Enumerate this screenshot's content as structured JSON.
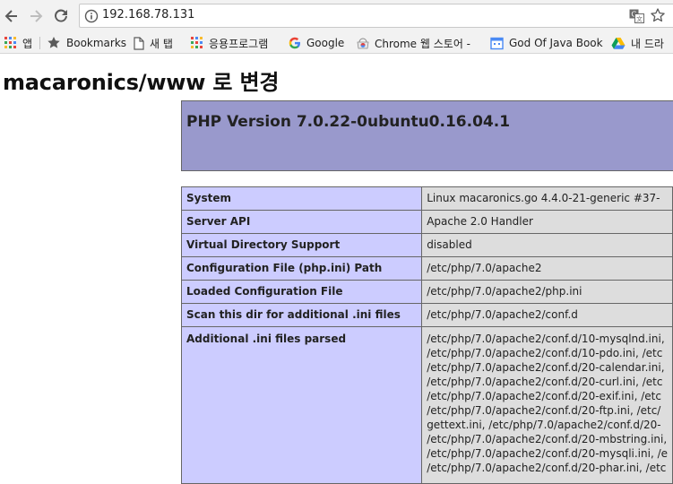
{
  "browser": {
    "url": "192.168.78.131",
    "bookmarks": [
      {
        "label": "앱",
        "icon": "apps-grid-icon"
      },
      {
        "label": "Bookmarks",
        "icon": "star-icon"
      },
      {
        "label": "새 탭",
        "icon": "page-icon"
      },
      {
        "label": "응용프로그램",
        "icon": "apps-grid-icon"
      },
      {
        "label": "Google",
        "icon": "google-icon"
      },
      {
        "label": "Chrome 웹 스토어 -",
        "icon": "webstore-icon"
      },
      {
        "label": "God Of Java Book",
        "icon": "calendar-icon"
      },
      {
        "label": "내 드라",
        "icon": "drive-icon"
      }
    ]
  },
  "page": {
    "title": "macaronics/www 로 변경",
    "php_version": "PHP Version 7.0.22-0ubuntu0.16.04.1",
    "rows": [
      {
        "key": "System",
        "value": "Linux macaronics.go 4.4.0-21-generic #37-"
      },
      {
        "key": "Server API",
        "value": "Apache 2.0 Handler"
      },
      {
        "key": "Virtual Directory Support",
        "value": "disabled"
      },
      {
        "key": "Configuration File (php.ini) Path",
        "value": "/etc/php/7.0/apache2"
      },
      {
        "key": "Loaded Configuration File",
        "value": "/etc/php/7.0/apache2/php.ini"
      },
      {
        "key": "Scan this dir for additional .ini files",
        "value": "/etc/php/7.0/apache2/conf.d"
      }
    ],
    "additional_ini": {
      "key": "Additional .ini files parsed",
      "lines": [
        "/etc/php/7.0/apache2/conf.d/10-mysqlnd.ini,",
        "/etc/php/7.0/apache2/conf.d/10-pdo.ini, /etc",
        "/etc/php/7.0/apache2/conf.d/20-calendar.ini,",
        "/etc/php/7.0/apache2/conf.d/20-curl.ini, /etc",
        "/etc/php/7.0/apache2/conf.d/20-exif.ini, /etc",
        "/etc/php/7.0/apache2/conf.d/20-ftp.ini, /etc/",
        "gettext.ini, /etc/php/7.0/apache2/conf.d/20-",
        "/etc/php/7.0/apache2/conf.d/20-mbstring.ini,",
        "/etc/php/7.0/apache2/conf.d/20-mysqli.ini, /e",
        "/etc/php/7.0/apache2/conf.d/20-phar.ini, /etc"
      ]
    }
  },
  "colors": {
    "header_bg": "#9999cc",
    "key_bg": "#ccccff",
    "value_bg": "#dddddd",
    "border": "#666666"
  }
}
